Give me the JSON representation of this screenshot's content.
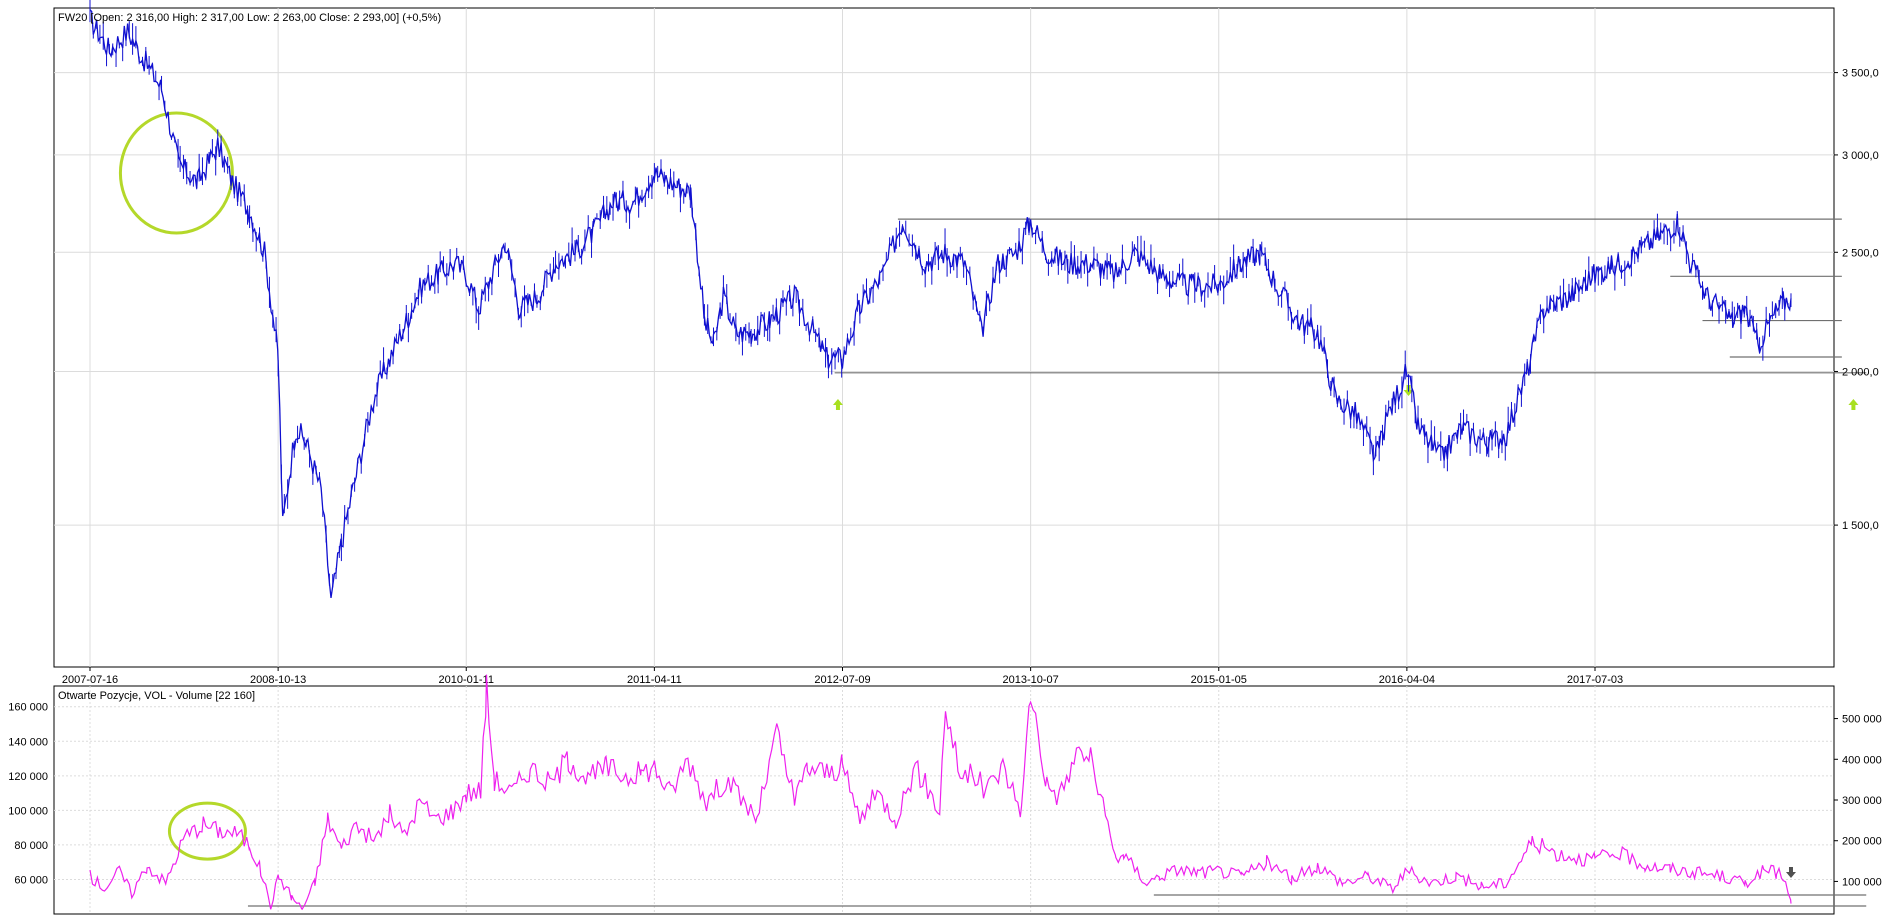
{
  "colors": {
    "price_series": "#1010d0",
    "volume_series": "#ee22ee",
    "highlight_circle": "#b4d82a",
    "arrow_green": "#a8e020",
    "arrow_dark": "#505050",
    "level_line": "#707070",
    "grid": "#dcdcdc",
    "frame": "#000000"
  },
  "chart_data": [
    {
      "type": "line",
      "title": "FW20 [Open: 2 316,00  High: 2 317,00  Low: 2 263,00  Close: 2 293,00] (+0,5%)",
      "y_scale": "log",
      "ylim": [
        1150,
        3950
      ],
      "y_ticks": [
        1500,
        2000,
        2500,
        3000,
        3500
      ],
      "y_tick_labels": [
        "1 500,0",
        "2 000,0",
        "2 500,0",
        "3 000,0",
        "3 500,0"
      ],
      "x_tick_labels": [
        "2007-07-16",
        "2008-10-13",
        "2010-01-11",
        "2011-04-11",
        "2012-07-09",
        "2013-10-07",
        "2015-01-05",
        "2016-04-04",
        "2017-07-03"
      ],
      "x_tick_dates": [
        "2007-07-16",
        "2008-10-13",
        "2010-01-11",
        "2011-04-11",
        "2012-07-09",
        "2013-10-07",
        "2015-01-05",
        "2016-04-04",
        "2017-07-03"
      ],
      "xlim": [
        "2007-04-12",
        "2019-05-06"
      ],
      "grid": true,
      "series": [
        {
          "x": [
            "2007-07-16",
            "2007-09-01",
            "2007-10-15",
            "2007-11-20",
            "2008-01-05",
            "2008-02-15",
            "2008-04-01",
            "2008-05-20",
            "2008-06-25",
            "2008-08-05",
            "2008-09-10",
            "2008-10-13",
            "2008-10-24",
            "2008-11-25",
            "2008-12-20",
            "2009-01-25",
            "2009-02-18",
            "2009-03-15",
            "2009-04-20",
            "2009-06-01",
            "2009-07-10",
            "2009-08-20",
            "2009-09-25",
            "2009-11-05",
            "2009-12-15",
            "2010-01-11",
            "2010-02-10",
            "2010-04-15",
            "2010-05-20",
            "2010-07-01",
            "2010-08-15",
            "2010-10-01",
            "2010-11-15",
            "2011-01-01",
            "2011-02-20",
            "2011-04-11",
            "2011-05-20",
            "2011-07-08",
            "2011-08-10",
            "2011-09-01",
            "2011-09-25",
            "2011-10-25",
            "2011-12-01",
            "2012-01-15",
            "2012-03-15",
            "2012-05-01",
            "2012-06-01",
            "2012-07-09",
            "2012-08-20",
            "2012-10-15",
            "2012-12-01",
            "2013-01-25",
            "2013-03-15",
            "2013-05-01",
            "2013-06-10",
            "2013-07-20",
            "2013-09-01",
            "2013-10-07",
            "2013-11-15",
            "2014-01-05",
            "2014-03-01",
            "2014-05-01",
            "2014-06-15",
            "2014-08-15",
            "2014-10-15",
            "2015-01-05",
            "2015-03-01",
            "2015-04-15",
            "2015-05-25",
            "2015-07-15",
            "2015-09-01",
            "2015-10-15",
            "2015-12-01",
            "2016-01-20",
            "2016-02-20",
            "2016-04-04",
            "2016-05-01",
            "2016-06-25",
            "2016-08-15",
            "2016-10-15",
            "2016-12-01",
            "2017-01-20",
            "2017-03-01",
            "2017-05-01",
            "2017-07-03",
            "2017-09-01",
            "2017-11-15",
            "2018-01-20",
            "2018-02-20",
            "2018-04-01",
            "2018-06-01",
            "2018-07-01",
            "2018-08-01",
            "2018-09-01",
            "2018-10-01",
            "2018-10-20"
          ],
          "values": [
            3870,
            3650,
            3780,
            3600,
            3400,
            2950,
            2850,
            3050,
            2850,
            2700,
            2500,
            2050,
            1500,
            1800,
            1750,
            1600,
            1300,
            1450,
            1650,
            1900,
            2050,
            2200,
            2350,
            2400,
            2450,
            2400,
            2250,
            2550,
            2250,
            2300,
            2450,
            2500,
            2600,
            2750,
            2750,
            2900,
            2850,
            2800,
            2200,
            2100,
            2300,
            2150,
            2150,
            2200,
            2300,
            2150,
            2050,
            2050,
            2250,
            2400,
            2650,
            2450,
            2500,
            2450,
            2150,
            2450,
            2500,
            2650,
            2500,
            2450,
            2450,
            2400,
            2500,
            2400,
            2350,
            2350,
            2450,
            2500,
            2350,
            2200,
            2150,
            1900,
            1850,
            1700,
            1850,
            2000,
            1800,
            1700,
            1800,
            1750,
            1780,
            2000,
            2250,
            2300,
            2400,
            2450,
            2550,
            2650,
            2450,
            2300,
            2200,
            2250,
            2100,
            2200,
            2280,
            2293
          ]
        }
      ]
    },
    {
      "type": "line",
      "title": "Otwarte Pozycje, VOL - Volume [22 160]",
      "grid": true,
      "left_axis": {
        "ylim": [
          40000,
          172000
        ],
        "ticks": [
          60000,
          80000,
          100000,
          120000,
          140000,
          160000
        ],
        "tick_labels": [
          "60 000",
          "80 000",
          "100 000",
          "120 000",
          "140 000",
          "160 000"
        ]
      },
      "right_axis": {
        "ticks": [
          100000,
          200000,
          300000,
          400000,
          500000
        ],
        "tick_labels": [
          "100 000",
          "200 000",
          "300 000",
          "400 000",
          "500 000"
        ]
      },
      "series": [
        {
          "axis": "left",
          "x": [
            "2007-07-16",
            "2007-08-20",
            "2007-09-25",
            "2007-10-25",
            "2007-12-01",
            "2008-01-15",
            "2008-03-01",
            "2008-04-15",
            "2008-05-25",
            "2008-07-05",
            "2008-08-05",
            "2008-09-01",
            "2008-09-25",
            "2008-10-15",
            "2008-11-15",
            "2008-12-10",
            "2009-01-10",
            "2009-02-10",
            "2009-03-15",
            "2009-04-20",
            "2009-06-01",
            "2009-07-10",
            "2009-08-15",
            "2009-09-20",
            "2009-10-30",
            "2009-12-10",
            "2010-01-11",
            "2010-02-15",
            "2010-03-01",
            "2010-03-20",
            "2010-05-01",
            "2010-06-15",
            "2010-08-01",
            "2010-09-15",
            "2010-11-01",
            "2010-12-15",
            "2011-02-01",
            "2011-03-10",
            "2011-04-11",
            "2011-05-20",
            "2011-07-01",
            "2011-08-15",
            "2011-10-01",
            "2011-12-15",
            "2012-02-01",
            "2012-03-15",
            "2012-04-15",
            "2012-06-01",
            "2012-07-09",
            "2012-08-20",
            "2012-10-01",
            "2012-11-15",
            "2013-01-01",
            "2013-03-01",
            "2013-03-15",
            "2013-04-20",
            "2013-06-01",
            "2013-06-15",
            "2013-08-01",
            "2013-09-15",
            "2013-10-07",
            "2013-11-15",
            "2013-12-15",
            "2014-02-01",
            "2014-03-01",
            "2014-05-01",
            "2014-05-20",
            "2014-06-10",
            "2014-07-15",
            "2014-08-15",
            "2014-10-01",
            "2014-11-15",
            "2015-01-05",
            "2015-03-01",
            "2015-05-01",
            "2015-07-01",
            "2015-09-01",
            "2015-11-01",
            "2016-01-01",
            "2016-03-01",
            "2016-04-04",
            "2016-06-01",
            "2016-08-01",
            "2016-10-01",
            "2016-12-01",
            "2017-02-01",
            "2017-04-01",
            "2017-06-01",
            "2017-07-03",
            "2017-09-01",
            "2017-11-01",
            "2018-01-01",
            "2018-03-01",
            "2018-05-01",
            "2018-07-01",
            "2018-08-15",
            "2018-09-15",
            "2018-10-01",
            "2018-10-20"
          ],
          "values": [
            62000,
            55000,
            65000,
            52000,
            68000,
            58000,
            85000,
            92000,
            88000,
            87000,
            80000,
            65000,
            45000,
            62000,
            50000,
            43000,
            58000,
            95000,
            78000,
            92000,
            82000,
            98000,
            85000,
            105000,
            95000,
            100000,
            110000,
            112000,
            170000,
            118000,
            110000,
            125000,
            115000,
            130000,
            118000,
            125000,
            120000,
            122000,
            125000,
            110000,
            130000,
            105000,
            118000,
            95000,
            145000,
            105000,
            125000,
            122000,
            125000,
            95000,
            110000,
            95000,
            125000,
            100000,
            160000,
            120000,
            120000,
            110000,
            125000,
            100000,
            170000,
            115000,
            108000,
            135000,
            130000,
            72000,
            75000,
            68000,
            58000,
            62000,
            66000,
            64000,
            65000,
            62000,
            70000,
            60000,
            68000,
            58000,
            62000,
            55000,
            65000,
            58000,
            62000,
            56000,
            58000,
            82000,
            75000,
            72000,
            72000,
            75000,
            68000,
            66000,
            64000,
            62000,
            58000,
            65000,
            64000,
            62000,
            46000
          ]
        }
      ]
    }
  ]
}
